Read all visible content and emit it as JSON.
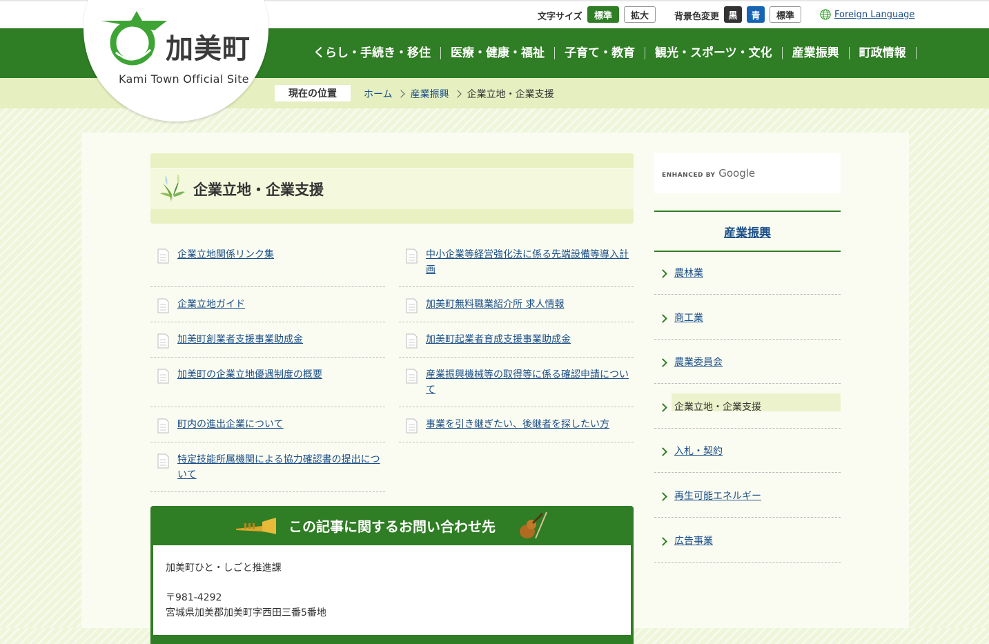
{
  "header": {
    "logo_name": "加美町",
    "logo_sub": "Kami Town Official Site",
    "font_size_label": "文字サイズ",
    "font_size_buttons": [
      "標準",
      "拡大"
    ],
    "bg_color_label": "背景色変更",
    "bg_color_buttons": [
      "黒",
      "青",
      "標準"
    ],
    "foreign_language": "Foreign Language"
  },
  "nav": {
    "items": [
      "くらし・手続き・移住",
      "医療・健康・福祉",
      "子育て・教育",
      "観光・スポーツ・文化",
      "産業振興",
      "町政情報"
    ]
  },
  "breadcrumb": {
    "label": "現在の位置",
    "items": [
      "ホーム",
      "産業振興",
      "企業立地・企業支援"
    ]
  },
  "page": {
    "title": "企業立地・企業支援",
    "links_left": [
      "企業立地関係リンク集",
      "企業立地ガイド",
      "加美町創業者支援事業助成金",
      "加美町の企業立地優遇制度の概要",
      "町内の進出企業について",
      "特定技能所属機関による協力確認書の提出について"
    ],
    "links_right": [
      "中小企業等経営強化法に係る先端設備等導入計画",
      "加美町無料職業紹介所 求人情報",
      "加美町起業者育成支援事業助成金",
      "産業振興機械等の取得等に係る確認申請について",
      "事業を引き継ぎたい、後継者を探したい方"
    ]
  },
  "contact": {
    "title": "この記事に関するお問い合わせ先",
    "department": "加美町ひと・しごと推進課",
    "postal": "〒981-4292",
    "address": "宮城県加美郡加美町字西田三番5番地"
  },
  "sidebar": {
    "search_enhanced": "ENHANCED BY",
    "search_brand": "Google",
    "heading": "産業振興",
    "items": [
      "農林業",
      "商工業",
      "農業委員会",
      "企業立地・企業支援",
      "入札・契約",
      "再生可能エネルギー",
      "広告事業"
    ],
    "current_index": 3
  },
  "colors": {
    "brand_green": "#2f7d24",
    "light_green": "#e5efbf",
    "link_blue": "#1a4f8a",
    "bg_blue_button": "#1764b4"
  }
}
